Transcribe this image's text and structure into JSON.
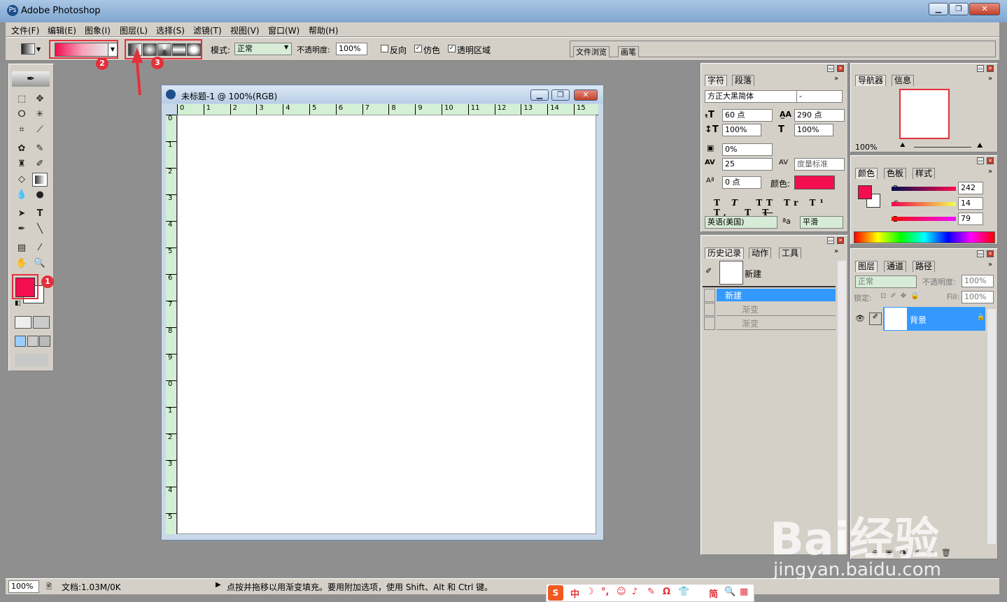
{
  "app_title": "Adobe Photoshop",
  "menu": [
    "文件(F)",
    "编辑(E)",
    "图象(I)",
    "图层(L)",
    "选择(S)",
    "滤镜(T)",
    "视图(V)",
    "窗口(W)",
    "帮助(H)"
  ],
  "options": {
    "mode_label": "模式:",
    "mode_value": "正常",
    "opacity_label": "不透明度:",
    "opacity_value": "100%",
    "reverse_label": "反向",
    "dither_label": "仿色",
    "transparency_label": "透明区域",
    "palette_tab1": "文件浏览",
    "palette_tab2": "画笔"
  },
  "annotations": {
    "one": "1",
    "two": "2",
    "three": "3"
  },
  "colors": {
    "foreground": "#f20e4f",
    "accent_red": "#e2313b",
    "highlight": "#3399ff"
  },
  "document": {
    "title": "未标题-1 @ 100%(RGB)",
    "hruler": [
      "0",
      "1",
      "2",
      "3",
      "4",
      "5",
      "6",
      "7",
      "8",
      "9",
      "10",
      "11",
      "12",
      "13",
      "14",
      "15"
    ],
    "vruler": [
      "0",
      "1",
      "2",
      "3",
      "4",
      "5",
      "6",
      "7",
      "8",
      "9",
      "0",
      "1",
      "2",
      "3",
      "4",
      "5"
    ]
  },
  "character": {
    "tab1": "字符",
    "tab2": "段落",
    "font": "方正大黑简体",
    "style": "-",
    "size": "60 点",
    "leading": "290 点",
    "vscale": "100%",
    "hscale": "100%",
    "tracking_pct": "0%",
    "kerning": "25",
    "kerning_preset": "度量标准",
    "baseline": "0 点",
    "color_label": "颜色:",
    "language": "英语(美国)",
    "aa_label": "a",
    "aa_value": "平滑",
    "styles": [
      "T",
      "T",
      "TT",
      "Tr",
      "T¹",
      "T,",
      "T",
      "T"
    ]
  },
  "history": {
    "tab1": "历史记录",
    "tab2": "动作",
    "tab3": "工具",
    "snapshot": "新建",
    "items": [
      "新建",
      "渐变",
      "渐变"
    ]
  },
  "navigator": {
    "tab1": "导航器",
    "tab2": "信息",
    "zoom": "100%"
  },
  "color_panel": {
    "tab1": "颜色",
    "tab2": "色板",
    "tab3": "样式",
    "r_label": "R",
    "g_label": "G",
    "b_label": "B",
    "r": "242",
    "g": "14",
    "b": "79"
  },
  "layers": {
    "tab1": "图层",
    "tab2": "通道",
    "tab3": "路径",
    "blend": "正常",
    "opacity_label": "不透明度:",
    "opacity": "100%",
    "lock_label": "锁定:",
    "fill_label": "Fill:",
    "fill": "100%",
    "layer_name": "背景"
  },
  "status": {
    "zoom": "100%",
    "doc_info": "文档:1.03M/0K",
    "hint": "点按并拖移以用渐变填充。要用附加选项，使用 Shift、Alt 和 Ctrl 键。"
  },
  "ime": {
    "items": [
      "中",
      "☽",
      "°,",
      "☺",
      "♪",
      "✎",
      "Ω",
      "👕",
      "简",
      "🔍",
      "▦"
    ]
  },
  "watermark": {
    "brand": "Bai经验",
    "url": "jingyan.baidu.com"
  }
}
